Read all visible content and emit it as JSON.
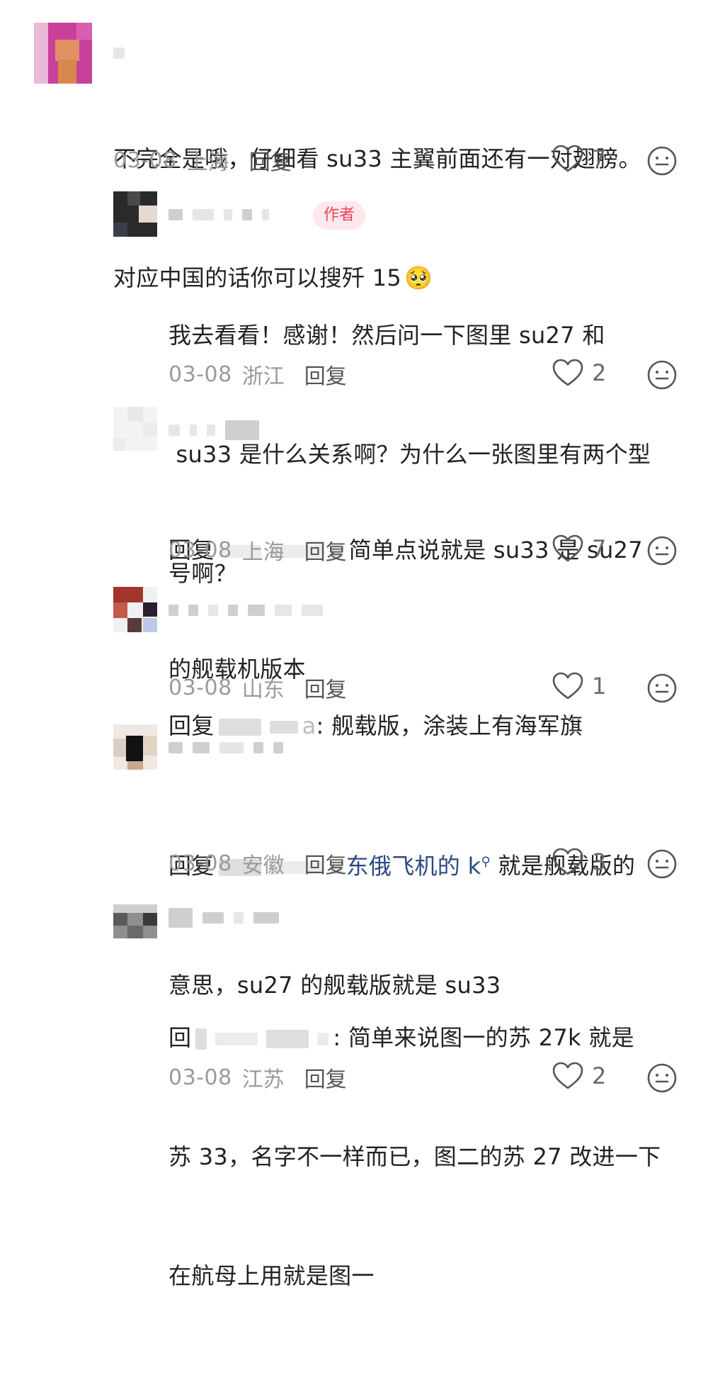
{
  "comments": [
    {
      "text1": "不完全是哦，仔细看 su33 主翼前面还有一对翅膀。",
      "text2": "对应中国的话你可以搜歼 15",
      "emoji": "🥺",
      "date": "03-08",
      "location": "上海",
      "reply": "回复",
      "likes": "7"
    },
    {
      "author_badge": "作者",
      "text1": "我去看看！感谢！然后问一下图里 su27 和",
      "text2": " su33 是什么关系啊？为什么一张图里有两个型",
      "text3": "号啊？",
      "date": "03-08",
      "location": "浙江",
      "reply": "回复",
      "likes": "2"
    },
    {
      "prefix": "回复",
      "text1": "简单点说就是 su33 是 su27",
      "text2": "的舰载机版本",
      "date": "03-08",
      "location": "上海",
      "reply": "回复",
      "likes": "7"
    },
    {
      "prefix": "回复",
      "partial": "a",
      "text1": ": 舰载版，涂装上有海军旗",
      "date": "03-08",
      "location": "山东",
      "reply": "回复",
      "likes": "1"
    },
    {
      "prefix": "回复",
      "link": "东俄飞机的 k",
      "search_glyph": "⚲",
      "text1": " 就是舰载版的",
      "text2": "意思，su27 的舰载版就是 su33",
      "date": "03-08",
      "location": "安徽",
      "reply": "回复",
      "likes": "3"
    },
    {
      "prefix": "回",
      "text1": ": 简单来说图一的苏 27k 就是",
      "text2": "苏 33，名字不一样而已，图二的苏 27 改进一下",
      "text3": "在航母上用就是图一",
      "date": "03-08",
      "location": "江苏",
      "reply": "回复",
      "likes": "2"
    }
  ],
  "icons": {
    "like": "heart-outline-icon",
    "dislike": "neutral-face-icon"
  },
  "colors": {
    "text": "#222222",
    "meta": "#9a9a9a",
    "badge_bg": "#fde8ec",
    "badge_fg": "#e8455c",
    "link": "#2b4a83"
  }
}
